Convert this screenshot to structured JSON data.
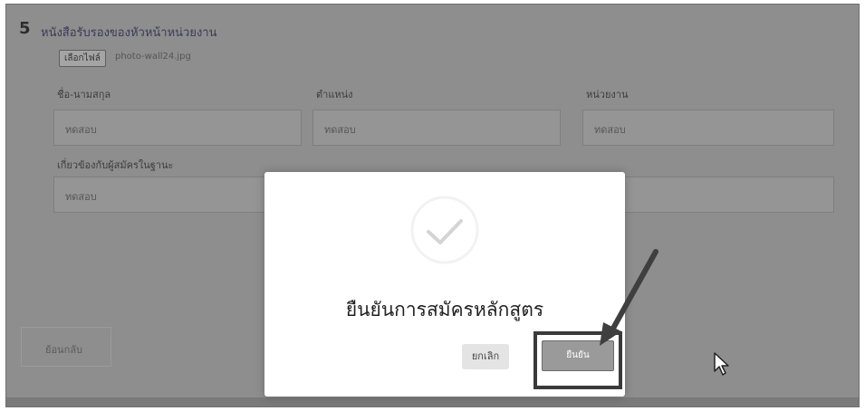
{
  "section": {
    "number": "5",
    "title": "หนังสือรับรองของหัวหน้าหน่วยงาน",
    "file_button_label": "เลือกไฟล์",
    "file_name": "photo-wall24.jpg"
  },
  "fields": {
    "name_label": "ชื่อ-นามสกุล",
    "name_value": "ทดสอบ",
    "position_label": "ตำแหน่ง",
    "position_value": "ทดสอบ",
    "unit_label": "หน่วยงาน",
    "unit_value": "ทดสอบ",
    "relation_label": "เกี่ยวข้องกับผู้สมัครในฐานะ",
    "relation_value": "ทดสอบ"
  },
  "back_button_label": "ย้อนกลับ",
  "dialog": {
    "icon": "checkmark-icon",
    "title": "ยืนยันการสมัครหลักสูตร",
    "cancel_label": "ยกเลิก",
    "confirm_label": "ยืนยัน"
  },
  "colors": {
    "overlay": "#8e8e8e",
    "dialog_bg": "#ffffff",
    "highlight_border": "#3a3a3a"
  }
}
